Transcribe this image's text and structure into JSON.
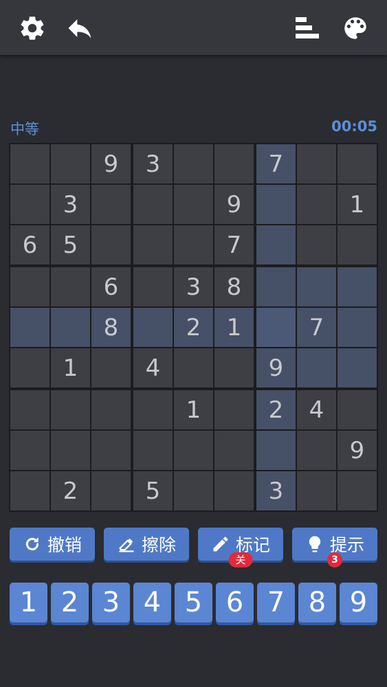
{
  "toolbar": {
    "settings_icon": "gear-icon",
    "undo_icon": "undo-arrow-icon",
    "stats_icon": "bar-chart-icon",
    "theme_icon": "palette-icon"
  },
  "header": {
    "difficulty": "中等",
    "timer": "00:05"
  },
  "board": {
    "rows": [
      [
        "",
        "",
        "9",
        "3",
        "",
        "",
        "7",
        "",
        ""
      ],
      [
        "",
        "3",
        "",
        "",
        "",
        "9",
        "",
        "",
        "1"
      ],
      [
        "6",
        "5",
        "",
        "",
        "",
        "7",
        "",
        "",
        ""
      ],
      [
        "",
        "",
        "6",
        "",
        "3",
        "8",
        "",
        "",
        ""
      ],
      [
        "",
        "",
        "8",
        "",
        "2",
        "1",
        "",
        "7",
        ""
      ],
      [
        "",
        "1",
        "",
        "4",
        "",
        "",
        "9",
        "",
        ""
      ],
      [
        "",
        "",
        "",
        "",
        "1",
        "",
        "2",
        "4",
        ""
      ],
      [
        "",
        "",
        "",
        "",
        "",
        "",
        "",
        "",
        "9"
      ],
      [
        "",
        "2",
        "",
        "5",
        "",
        "",
        "3",
        "",
        ""
      ]
    ],
    "selected_row": 4,
    "selected_col": 6
  },
  "actions": [
    {
      "label": "撤销",
      "icon": "undo-circle-icon"
    },
    {
      "label": "擦除",
      "icon": "eraser-icon"
    },
    {
      "label": "标记",
      "icon": "pencil-icon",
      "badge": "关"
    },
    {
      "label": "提示",
      "icon": "lightbulb-icon",
      "badge": "3"
    }
  ],
  "numpad": [
    "1",
    "2",
    "3",
    "4",
    "5",
    "6",
    "7",
    "8",
    "9"
  ],
  "colors": {
    "accent": "#4f79c7",
    "badge": "#e12a3a",
    "background": "#2a2c31"
  }
}
